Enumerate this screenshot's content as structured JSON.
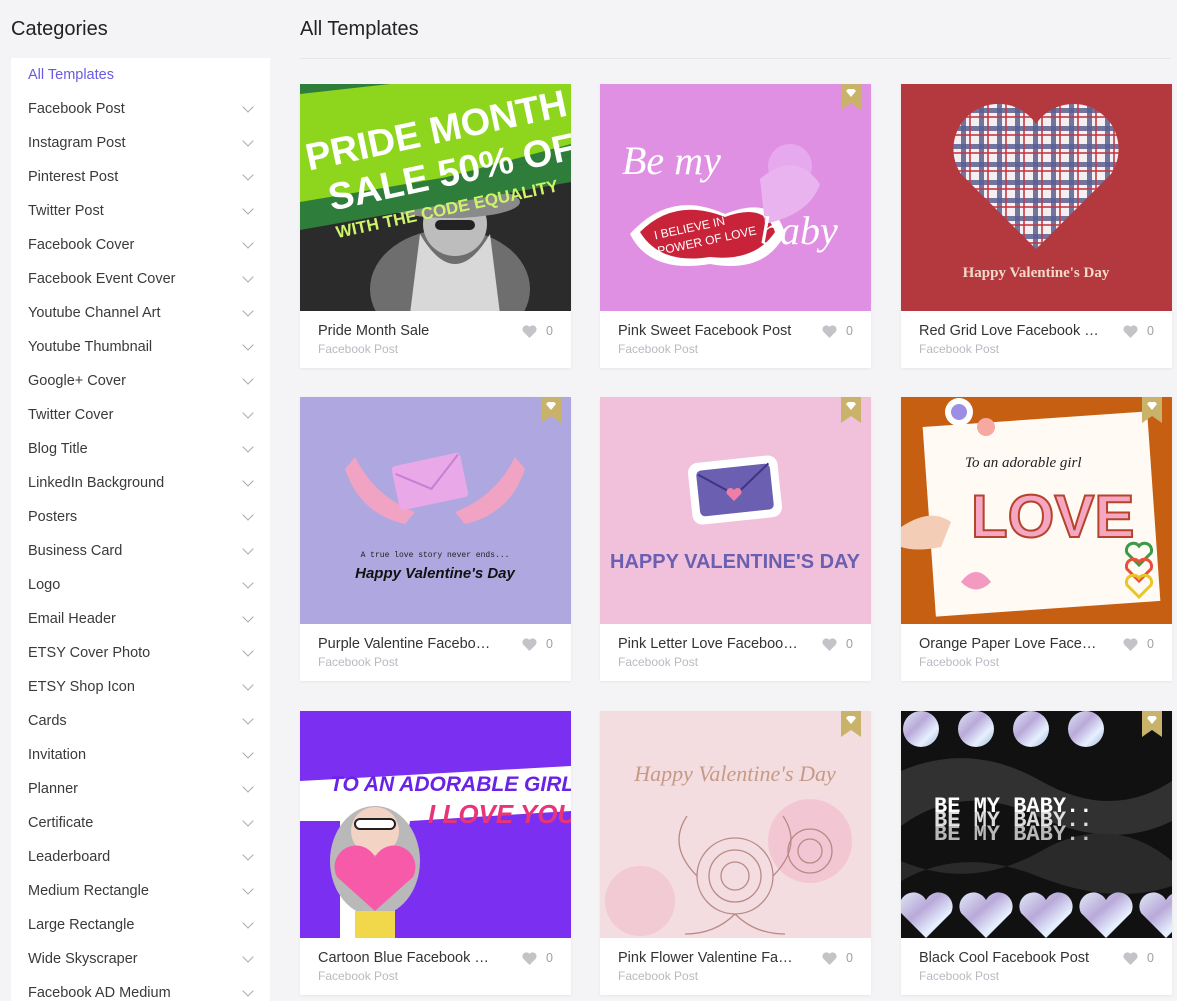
{
  "sidebar": {
    "title": "Categories",
    "items": [
      {
        "label": "All Templates",
        "active": true,
        "chevron": false
      },
      {
        "label": "Facebook Post",
        "chevron": true
      },
      {
        "label": "Instagram Post",
        "chevron": true
      },
      {
        "label": "Pinterest Post",
        "chevron": true
      },
      {
        "label": "Twitter Post",
        "chevron": true
      },
      {
        "label": "Facebook Cover",
        "chevron": true
      },
      {
        "label": "Facebook Event Cover",
        "chevron": true
      },
      {
        "label": "Youtube Channel Art",
        "chevron": true
      },
      {
        "label": "Youtube Thumbnail",
        "chevron": true
      },
      {
        "label": "Google+ Cover",
        "chevron": true
      },
      {
        "label": "Twitter Cover",
        "chevron": true
      },
      {
        "label": "Blog Title",
        "chevron": true
      },
      {
        "label": "LinkedIn Background",
        "chevron": true
      },
      {
        "label": "Posters",
        "chevron": true
      },
      {
        "label": "Business Card",
        "chevron": true
      },
      {
        "label": "Logo",
        "chevron": true
      },
      {
        "label": "Email Header",
        "chevron": true
      },
      {
        "label": "ETSY Cover Photo",
        "chevron": true
      },
      {
        "label": "ETSY Shop Icon",
        "chevron": true
      },
      {
        "label": "Cards",
        "chevron": true
      },
      {
        "label": "Invitation",
        "chevron": true
      },
      {
        "label": "Planner",
        "chevron": true
      },
      {
        "label": "Certificate",
        "chevron": true
      },
      {
        "label": "Leaderboard",
        "chevron": true
      },
      {
        "label": "Medium Rectangle",
        "chevron": true
      },
      {
        "label": "Large Rectangle",
        "chevron": true
      },
      {
        "label": "Wide Skyscraper",
        "chevron": true
      },
      {
        "label": "Facebook AD Medium",
        "chevron": true
      }
    ]
  },
  "main": {
    "title": "All Templates",
    "templates": [
      {
        "name": "Pride Month Sale",
        "category": "Facebook Post",
        "likes": "0",
        "premium": false,
        "art": {
          "lines": [
            "PRIDE MONTH",
            "SALE 50% OF",
            "WITH THE CODE EQUALITY"
          ]
        }
      },
      {
        "name": "Pink Sweet Facebook Post",
        "category": "Facebook Post",
        "likes": "0",
        "premium": true,
        "art": {
          "lines": [
            "Be my",
            "I BELIEVE IN",
            "POWER OF LOVE",
            "baby"
          ]
        }
      },
      {
        "name": "Red Grid Love Facebook Post",
        "category": "Facebook Post",
        "likes": "0",
        "premium": false,
        "art": {
          "lines": [
            "Happy Valentine's Day"
          ]
        }
      },
      {
        "name": "Purple Valentine Facebook Post",
        "category": "Facebook Post",
        "likes": "0",
        "premium": true,
        "art": {
          "lines": [
            "A true love story never ends...",
            "Happy Valentine's Day"
          ]
        }
      },
      {
        "name": "Pink Letter Love Facebook Post",
        "category": "Facebook Post",
        "likes": "0",
        "premium": true,
        "art": {
          "lines": [
            "HAPPY VALENTINE'S DAY"
          ]
        }
      },
      {
        "name": "Orange Paper Love Facebook Post",
        "category": "Facebook Post",
        "likes": "0",
        "premium": true,
        "art": {
          "lines": [
            "To an adorable girl",
            "LOVE"
          ]
        }
      },
      {
        "name": "Cartoon Blue Facebook Post",
        "category": "Facebook Post",
        "likes": "0",
        "premium": false,
        "art": {
          "lines": [
            "TO AN ADORABLE GIRL",
            "I LOVE YOU"
          ]
        }
      },
      {
        "name": "Pink Flower Valentine Facebook Post",
        "category": "Facebook Post",
        "likes": "0",
        "premium": true,
        "art": {
          "lines": [
            "Happy Valentine's Day"
          ]
        }
      },
      {
        "name": "Black Cool Facebook Post",
        "category": "Facebook Post",
        "likes": "0",
        "premium": true,
        "art": {
          "lines": [
            "BE MY BABY.."
          ]
        }
      }
    ]
  },
  "colors": {
    "accent": "#6a5ae0",
    "premium_badge": "#c9b36b",
    "background": "#f4f4f7"
  }
}
